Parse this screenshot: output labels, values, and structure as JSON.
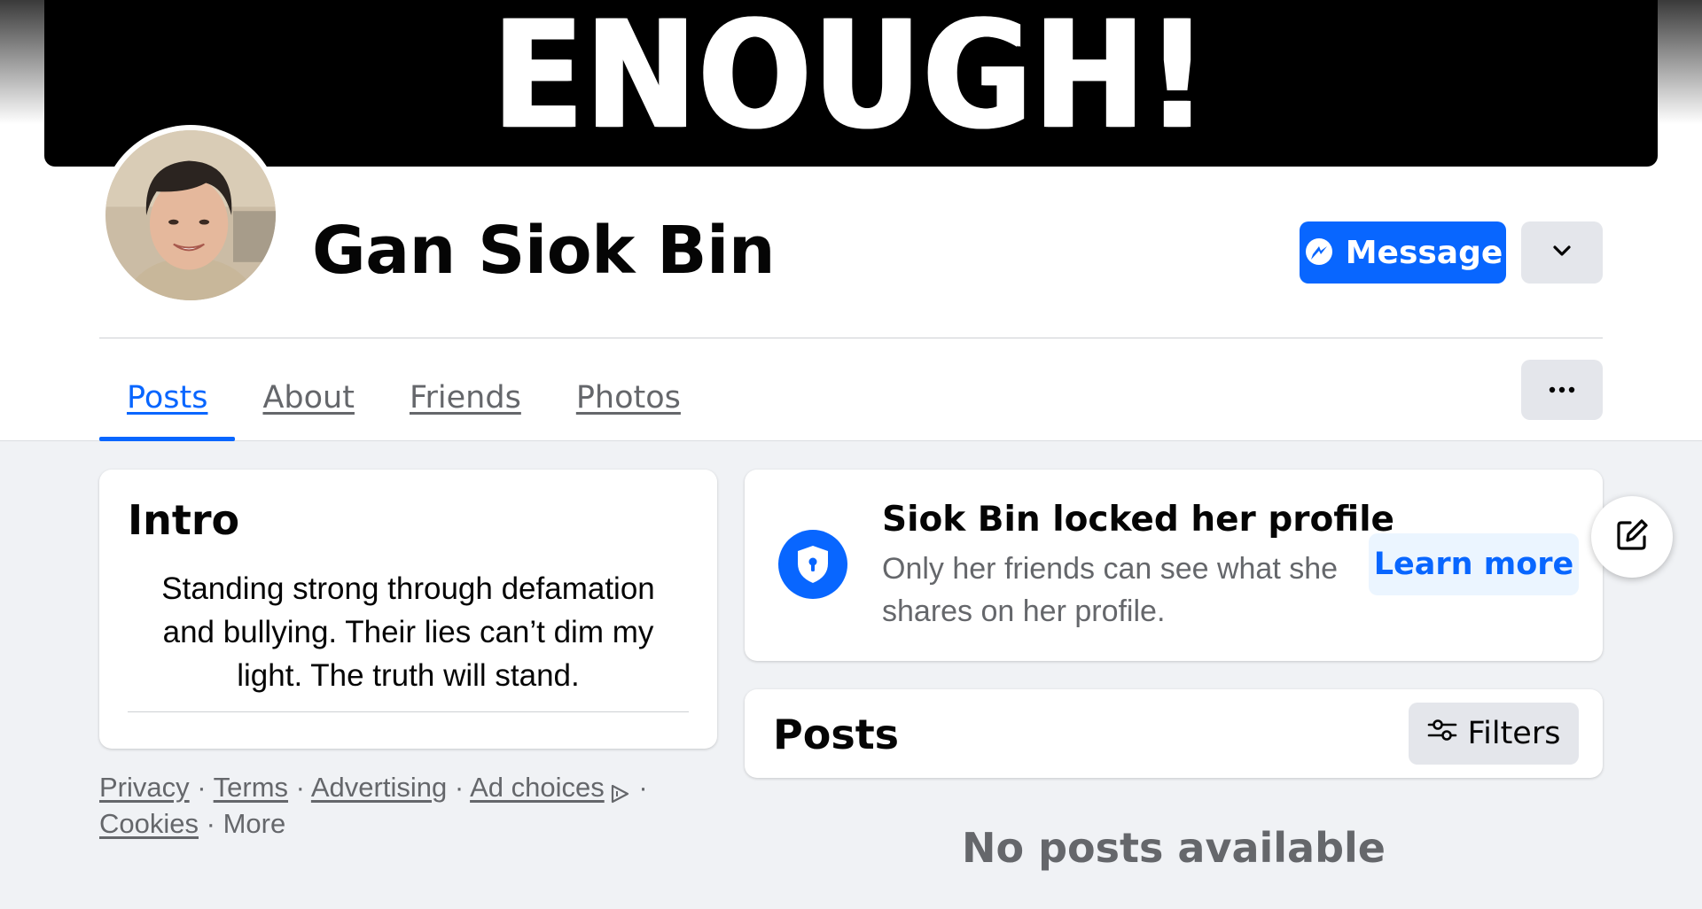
{
  "cover": {
    "text": "ENOUGH!"
  },
  "profile": {
    "name": "Gan Siok Bin"
  },
  "actions": {
    "message_label": "Message",
    "dropdown_icon": "chevron-down-icon",
    "more_icon": "ellipsis-icon"
  },
  "tabs": [
    {
      "label": "Posts",
      "active": true
    },
    {
      "label": "About",
      "active": false
    },
    {
      "label": "Friends",
      "active": false
    },
    {
      "label": "Photos",
      "active": false
    }
  ],
  "intro": {
    "title": "Intro",
    "bio": "Standing strong through defamation and bullying. Their lies can’t dim my light. The truth will stand."
  },
  "footer": {
    "privacy": "Privacy",
    "terms": "Terms",
    "advertising": "Advertising",
    "ad_choices": "Ad choices",
    "cookies": "Cookies",
    "more": "More",
    "sep": " · "
  },
  "locked": {
    "title": "Siok Bin locked her profile",
    "description": "Only her friends can see what she shares on her profile.",
    "learn_more": "Learn more"
  },
  "posts": {
    "title": "Posts",
    "filters_label": "Filters",
    "empty_text": "No posts available"
  },
  "colors": {
    "accent": "#0866ff",
    "background": "#f0f2f5",
    "secondary_text": "#65676b"
  }
}
